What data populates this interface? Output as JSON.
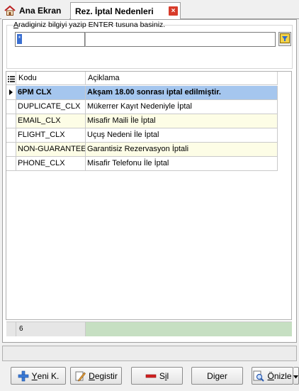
{
  "tabs": [
    {
      "label": "Ana Ekran"
    },
    {
      "label": "Rez. İptal Nedenleri",
      "close": "×"
    }
  ],
  "search": {
    "caption_hotkey": "A",
    "caption_rest": "radiginiz bilgiyi yazip ENTER tusuna basiniz.",
    "field1_value": "*",
    "field2_value": ""
  },
  "grid": {
    "columns": [
      "Kodu",
      "Açiklama"
    ],
    "rows": [
      {
        "kodu": "6PM CLX",
        "aciklama": "Akşam 18.00 sonrası iptal edilmiştir."
      },
      {
        "kodu": "DUPLICATE_CLX",
        "aciklama": "Mükerrer Kayıt Nedeniyle İptal"
      },
      {
        "kodu": "EMAIL_CLX",
        "aciklama": "Misafir Maili İle İptal"
      },
      {
        "kodu": "FLIGHT_CLX",
        "aciklama": "Uçuş Nedeni İle İptal"
      },
      {
        "kodu": "NON-GUARANTEE",
        "aciklama": "Garantisiz Rezervasyon İptali"
      },
      {
        "kodu": "PHONE_CLX",
        "aciklama": "Misafir Telefonu İle İptal"
      }
    ],
    "footer_count": "6"
  },
  "buttons": {
    "yeni": {
      "hk": "Y",
      "rest": "eni K."
    },
    "degistir": {
      "hk": "D",
      "rest": "egistir"
    },
    "sil": {
      "pre": "S",
      "hk": "i",
      "rest": "l"
    },
    "diger": {
      "label": "Diger"
    },
    "onizle": {
      "hk": "Ö",
      "rest": "nizle"
    }
  },
  "colors": {
    "selected_row": "#a5c6ee",
    "alt_row": "#fdfde6",
    "footer_green": "#c6dfc2",
    "tab_close": "#d83b2a"
  }
}
